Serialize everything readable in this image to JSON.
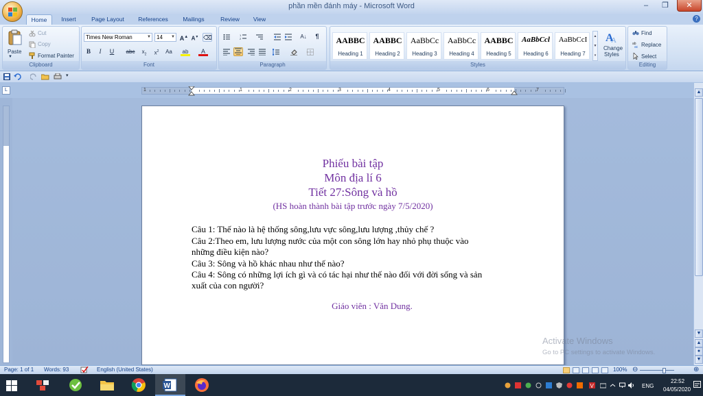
{
  "title": "phần mền đánh máy - Microsoft Word",
  "tabs": [
    "Home",
    "Insert",
    "Page Layout",
    "References",
    "Mailings",
    "Review",
    "View"
  ],
  "clipboard": {
    "paste": "Paste",
    "cut": "Cut",
    "copy": "Copy",
    "format_painter": "Format Painter",
    "label": "Clipboard"
  },
  "font": {
    "name": "Times New Roman",
    "size": "14",
    "label": "Font"
  },
  "paragraph": {
    "label": "Paragraph"
  },
  "styles": {
    "items": [
      {
        "sample": "AABBC",
        "name": "Heading 1"
      },
      {
        "sample": "AABBC",
        "name": "Heading 2"
      },
      {
        "sample": "AaBbCc",
        "name": "Heading 3"
      },
      {
        "sample": "AaBbCc",
        "name": "Heading 4"
      },
      {
        "sample": "AABBC",
        "name": "Heading 5"
      },
      {
        "sample": "AaBbCcl",
        "name": "Heading 6"
      },
      {
        "sample": "AaBbCcI",
        "name": "Heading 7"
      }
    ],
    "change_styles": [
      "Change",
      "Styles"
    ],
    "label": "Styles"
  },
  "editing": {
    "find": "Find",
    "replace": "Replace",
    "select": "Select",
    "label": "Editing"
  },
  "ruler_numbers": [
    "1",
    "1",
    "2",
    "3",
    "4",
    "5",
    "6",
    "7"
  ],
  "document": {
    "title_lines": [
      "Phiếu bài tập",
      "Môn địa lí 6",
      "Tiết 27:Sông và hồ"
    ],
    "note": "(HS hoàn thành bài tập trước ngày 7/5/2020)",
    "questions": [
      "Câu 1: Thế nào là hệ thống sông,lưu vực sông,lưu lượng ,thủy chế ?",
      "Câu 2:Theo em, lưu lượng nước của một con sông lớn hay nhỏ phụ thuộc vào",
      "những điều kiện nào?",
      "Câu 3: Sông và hồ khác nhau như thế nào?",
      "Câu 4: Sông có những lợi ích gì và có tác hại như thế nào đối với đời sống và sản",
      "xuất của con người?"
    ],
    "teacher": "Giáo viên : Văn Dung."
  },
  "watermark": {
    "line1": "Activate Windows",
    "line2": "Go to PC settings to activate Windows."
  },
  "status": {
    "page": "Page: 1 of 1",
    "words": "Words: 93",
    "language": "English (United States)",
    "zoom": "100%"
  },
  "taskbar": {
    "lang": "ENG",
    "time": "22:52",
    "date": "04/05/2020"
  }
}
